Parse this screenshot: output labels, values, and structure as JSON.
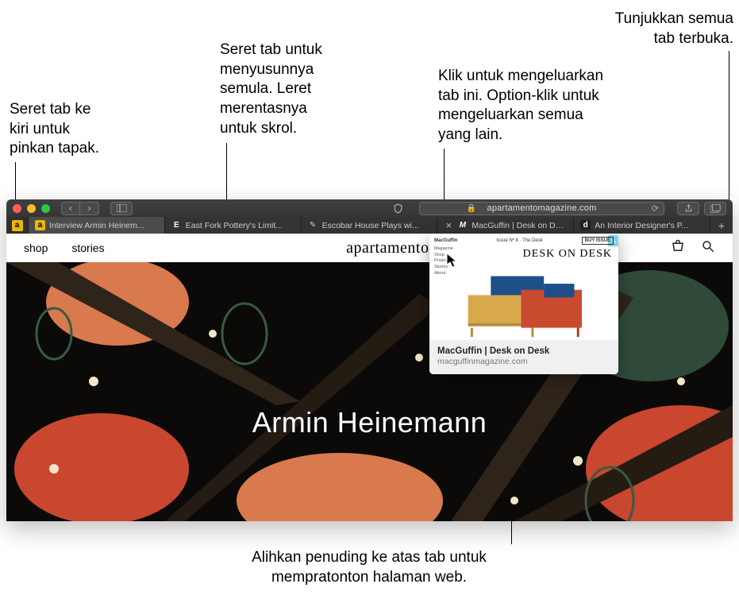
{
  "callouts": {
    "pin": "Seret tab ke\nkiri untuk\npinkan tapak.",
    "drag": "Seret tab untuk\nmenyusunnya\nsemula. Leret\nmerentasnya\nuntuk skrol.",
    "showall": "Tunjukkan semua\ntab terbuka.",
    "close": "Klik untuk mengeluarkan\ntab ini. Option-klik untuk\nmengeluarkan semua\nyang lain.",
    "hover": "Alihkan penuding ke atas tab untuk\nmempratonton halaman web."
  },
  "browser": {
    "address": "apartamentomagazine.com",
    "pinned_fav": "a",
    "tabs": [
      {
        "fav": "a",
        "favclass": "fav-a",
        "label": "Interview Armin Heinem..."
      },
      {
        "fav": "E",
        "favclass": "fav-e",
        "label": "East Fork Pottery's Limit..."
      },
      {
        "fav": "✎",
        "favclass": "",
        "label": "Escobar House Plays wi..."
      },
      {
        "fav": "M",
        "favclass": "fav-m",
        "label": "MacGuffin | Desk on De...",
        "close": true
      },
      {
        "fav": "d",
        "favclass": "fav-d",
        "label": "An Interior Designer's P..."
      }
    ]
  },
  "site": {
    "nav": {
      "shop": "shop",
      "stories": "stories"
    },
    "logo": "apartamento",
    "hero_title": "Armin Heinemann"
  },
  "preview": {
    "brand": "MacGuffin",
    "issue": "Issue Nº 8 · The Desk",
    "buy": "BUY ISSUE",
    "links": [
      "Magazine",
      "Shop",
      "Projects",
      "Stories",
      "About"
    ],
    "title": "DESK ON DESK",
    "caption_title": "MacGuffin | Desk on Desk",
    "caption_url": "macguffinmagazine.com"
  }
}
